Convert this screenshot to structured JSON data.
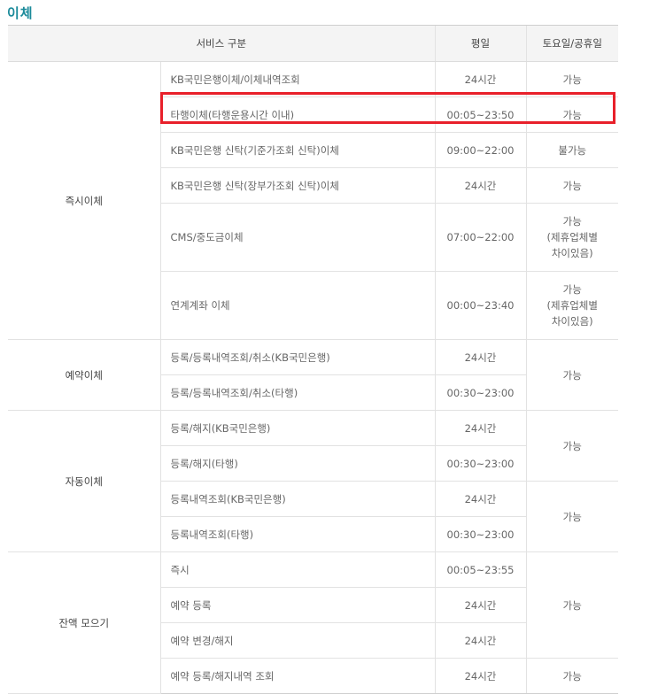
{
  "title": "이체",
  "headers": {
    "service": "서비스 구분",
    "weekday": "평일",
    "weekend": "토요일/공휴일"
  },
  "categories": {
    "instant": "즉시이체",
    "reserved": "예약이체",
    "auto": "자동이체",
    "balance": "잔액 모으기"
  },
  "rows": [
    {
      "item": "KB국민은행이체/이체내역조회",
      "weekday": "24시간",
      "weekend": "가능"
    },
    {
      "item": "타행이체(타행운용시간 이내)",
      "weekday": "00:05~23:50",
      "weekend": "가능"
    },
    {
      "item": "KB국민은행 신탁(기준가조회 신탁)이체",
      "weekday": "09:00~22:00",
      "weekend": "불가능"
    },
    {
      "item": "KB국민은행 신탁(장부가조회 신탁)이체",
      "weekday": "24시간",
      "weekend": "가능"
    },
    {
      "item": "CMS/중도금이체",
      "weekday": "07:00~22:00",
      "weekend_lines": [
        "가능",
        "(제휴업체별",
        "차이있음)"
      ]
    },
    {
      "item": "연계계좌 이체",
      "weekday": "00:00~23:40",
      "weekend_lines": [
        "가능",
        "(제휴업체별",
        "차이있음)"
      ]
    },
    {
      "item": "등록/등록내역조회/취소(KB국민은행)",
      "weekday": "24시간",
      "weekend": "가능"
    },
    {
      "item": "등록/등록내역조회/취소(타행)",
      "weekday": "00:30~23:00"
    },
    {
      "item": "등록/해지(KB국민은행)",
      "weekday": "24시간",
      "weekend": "가능"
    },
    {
      "item": "등록/해지(타행)",
      "weekday": "00:30~23:00"
    },
    {
      "item": "등록내역조회(KB국민은행)",
      "weekday": "24시간",
      "weekend": "가능"
    },
    {
      "item": "등록내역조회(타행)",
      "weekday": "00:30~23:00"
    },
    {
      "item": "즉시",
      "weekday": "00:05~23:55",
      "weekend": "가능"
    },
    {
      "item": "예약 등록",
      "weekday": "24시간"
    },
    {
      "item": "예약 변경/해지",
      "weekday": "24시간"
    },
    {
      "item": "예약 등록/해지내역 조회",
      "weekday": "24시간",
      "weekend": "가능"
    }
  ],
  "highlight_color": "#e8202a",
  "title_color": "#1a8a9a"
}
